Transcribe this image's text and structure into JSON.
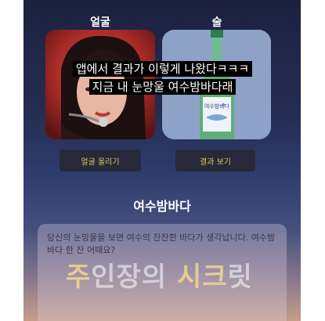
{
  "columns": {
    "face_title": "얼굴",
    "drink_title": "술"
  },
  "buttons": {
    "upload_face": "얼굴 올리기",
    "view_result": "결과 보기"
  },
  "bottle": {
    "label": "여수밤바다",
    "cap_color": "#2e7d4f",
    "glass_color": "#5fae79"
  },
  "result": {
    "title": "여수밤바다",
    "description": "당신의 눈망울을 보면 여수의 잔잔한 바다가 생각납니다. 여수밤바다 한 잔 어때요?"
  },
  "watermark": {
    "part1": "주",
    "part2": "인장의 ",
    "part3": "시크",
    "part4": "릿"
  },
  "caption": {
    "line1": "앱에서 결과가 이렇게 나왔다ㅋㅋㅋ",
    "line2": "지금 내 눈망울 여수밤바다래"
  }
}
